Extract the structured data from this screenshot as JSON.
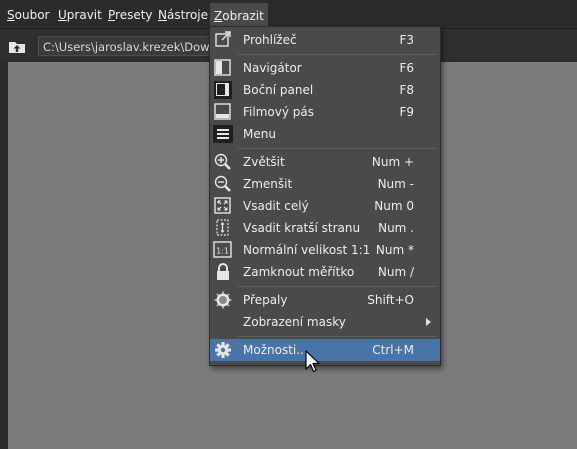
{
  "menubar": {
    "items": [
      {
        "label": "Soubor",
        "mnemonic": "S",
        "rest": "oubor"
      },
      {
        "label": "Upravit",
        "mnemonic": "U",
        "rest": "pravit"
      },
      {
        "label": "Presety",
        "mnemonic": "P",
        "rest": "resety"
      },
      {
        "label": "Nástroje",
        "mnemonic": "N",
        "rest": "ástroje"
      },
      {
        "label": "Zobrazit",
        "mnemonic": "Z",
        "rest": "obrazit"
      }
    ]
  },
  "toolbar": {
    "path_value": "C:\\Users\\jaroslav.krezek\\Downlo"
  },
  "menu": {
    "items": [
      {
        "label": "Prohlížeč",
        "shortcut": "F3",
        "icon": "open-external-icon"
      },
      {
        "label": "Navigátor",
        "shortcut": "F6",
        "icon": "navigator-panel-icon"
      },
      {
        "label": "Boční panel",
        "shortcut": "F8",
        "icon": "side-panel-icon"
      },
      {
        "label": "Filmový pás",
        "shortcut": "F9",
        "icon": "filmstrip-icon"
      },
      {
        "label": "Menu",
        "shortcut": "",
        "icon": "hamburger-menu-icon"
      },
      {
        "label": "Zvětšit",
        "shortcut": "Num +",
        "icon": "zoom-in-icon"
      },
      {
        "label": "Zmenšit",
        "shortcut": "Num -",
        "icon": "zoom-out-icon"
      },
      {
        "label": "Vsadit celý",
        "shortcut": "Num 0",
        "icon": "fit-all-icon"
      },
      {
        "label": "Vsadit kratší stranu",
        "shortcut": "Num .",
        "icon": "fit-short-side-icon"
      },
      {
        "label": "Normální velikost 1:1",
        "shortcut": "Num *",
        "icon": "actual-size-icon"
      },
      {
        "label": "Zamknout měřítko",
        "shortcut": "Num /",
        "icon": "lock-icon"
      },
      {
        "label": "Přepaly",
        "shortcut": "Shift+O",
        "icon": "overexposure-icon"
      },
      {
        "label": "Zobrazení masky",
        "shortcut": "",
        "icon": ""
      },
      {
        "label": "Možnosti...",
        "shortcut": "Ctrl+M",
        "icon": "gear-icon"
      }
    ],
    "icon_1to1_text": "1:1"
  },
  "colors": {
    "menu_bg": "#4a4a4a",
    "highlight": "#4874a8",
    "canvas": "#7b7b7b",
    "chrome": "#2b2b2b"
  }
}
